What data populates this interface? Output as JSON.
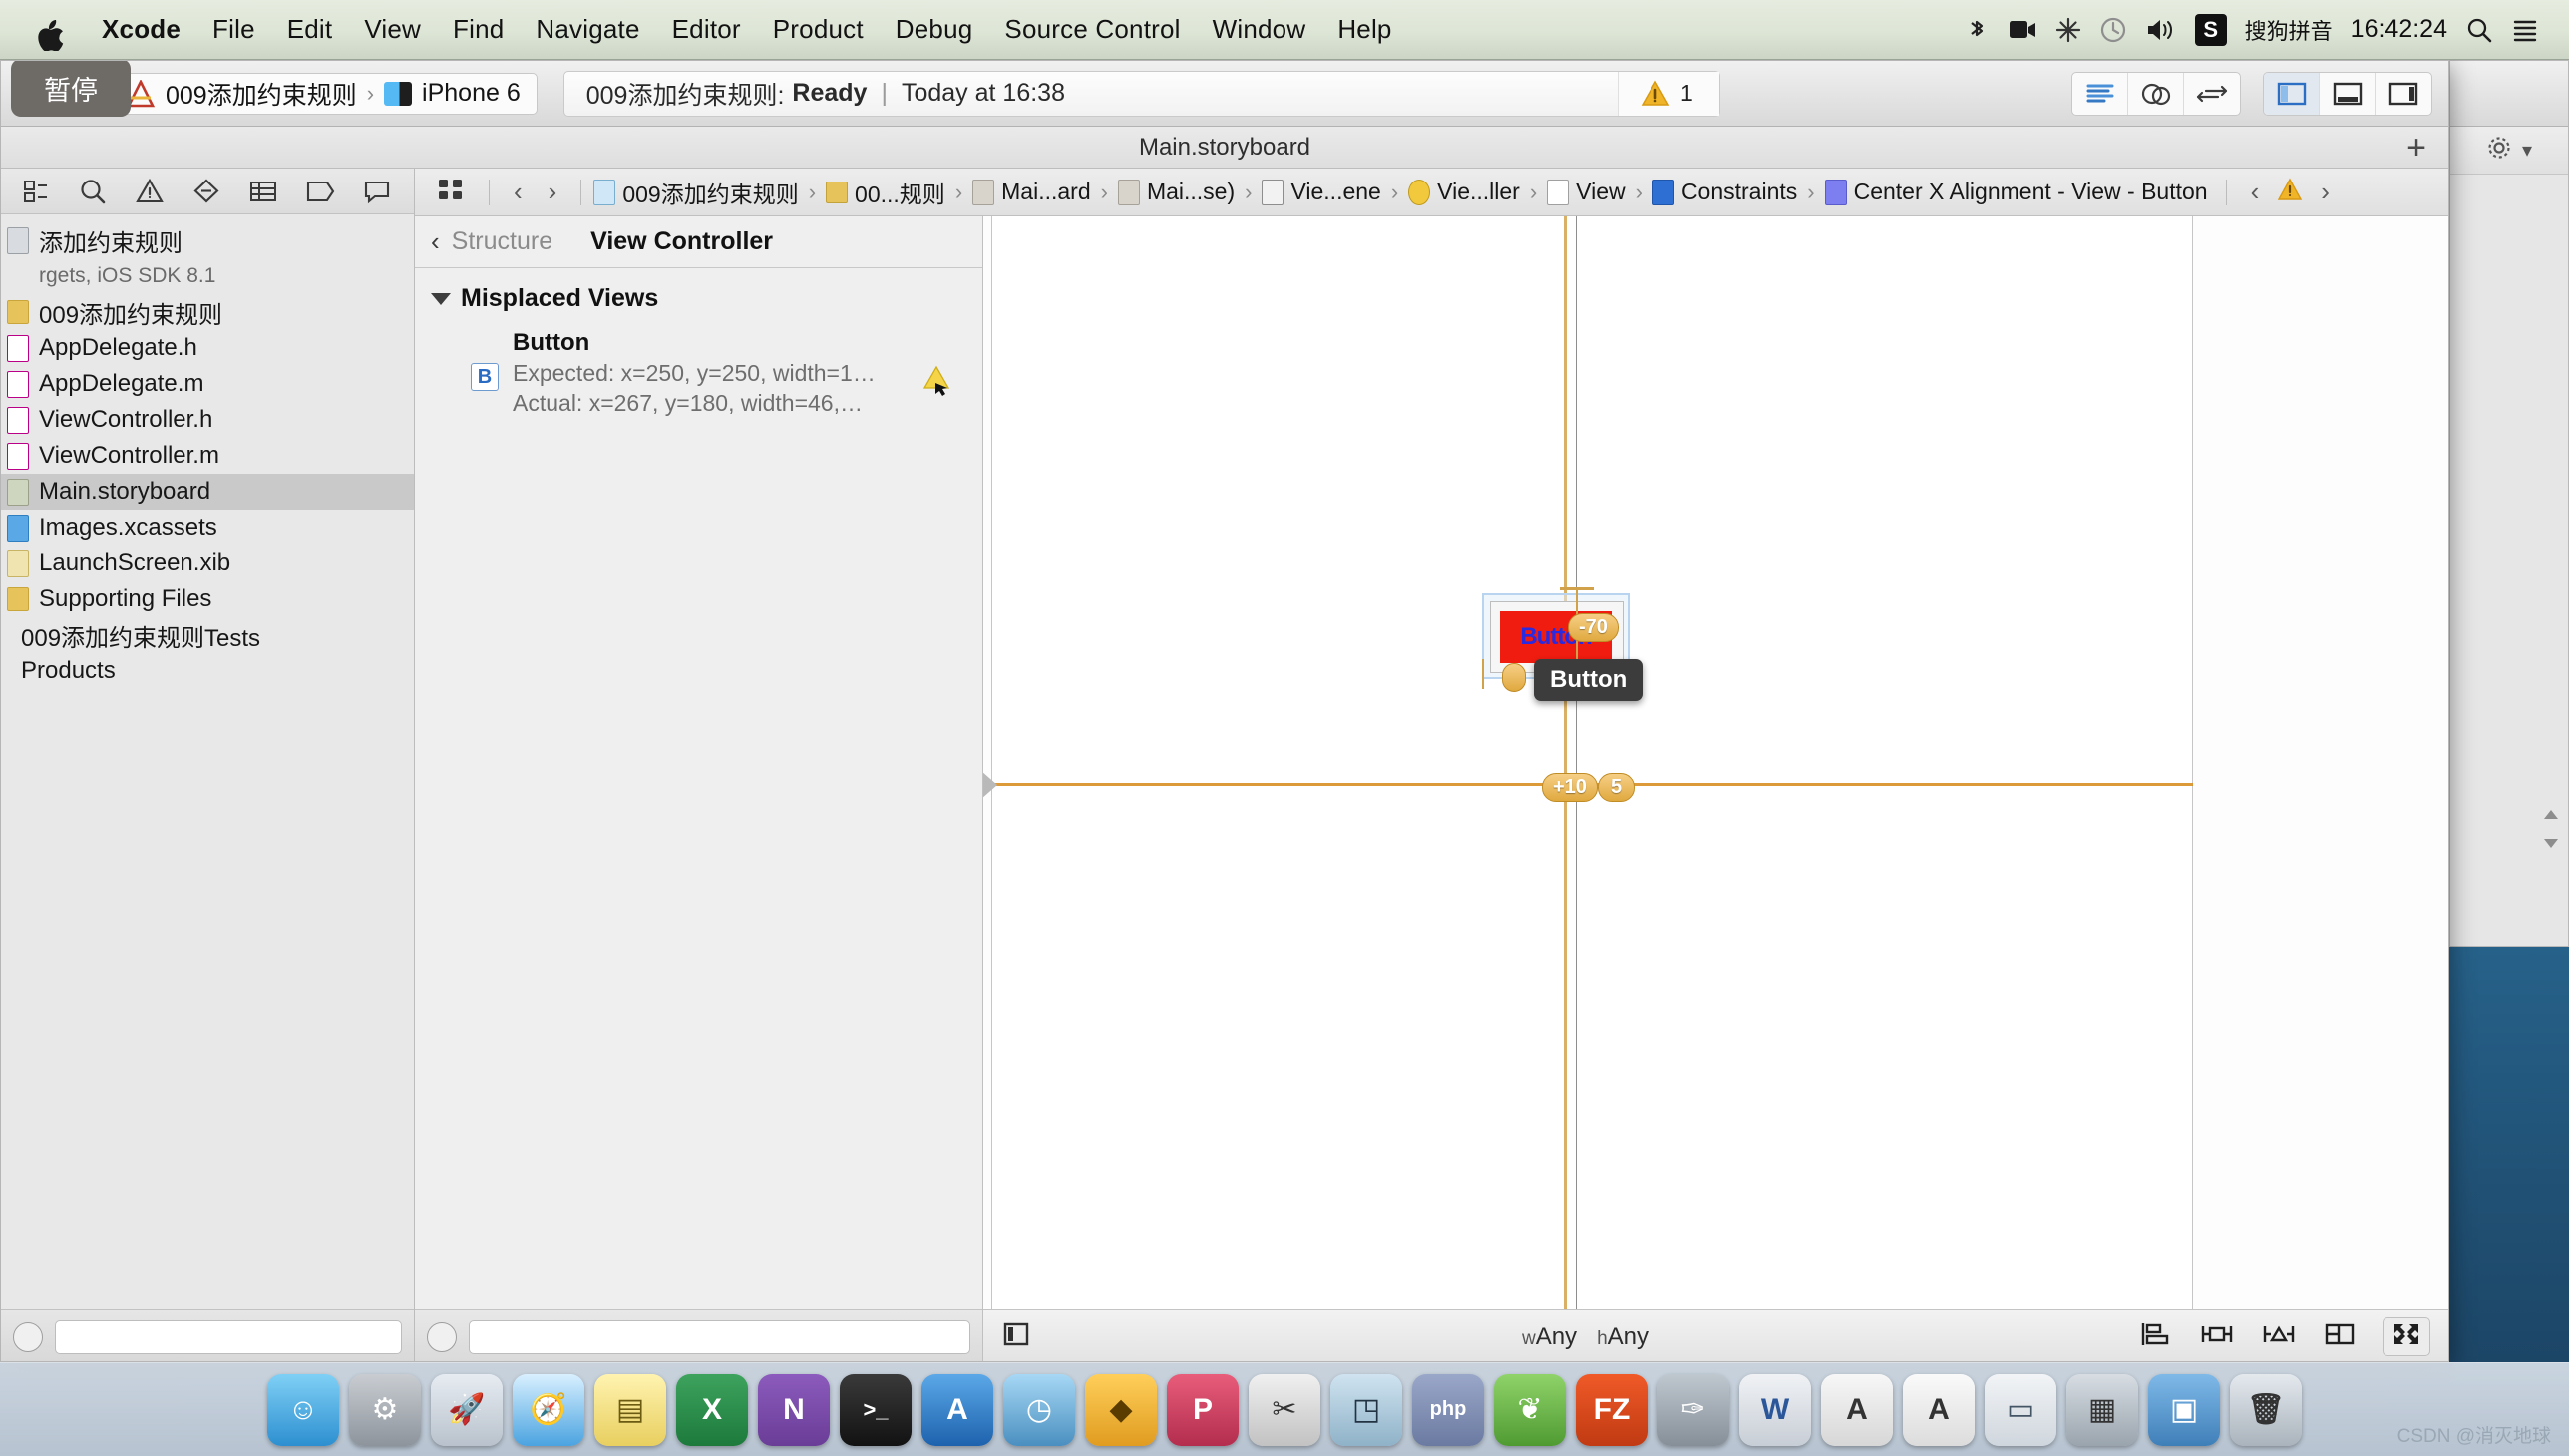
{
  "menubar": {
    "apple_icon": "apple-icon",
    "items": [
      "Xcode",
      "File",
      "Edit",
      "View",
      "Find",
      "Navigate",
      "Editor",
      "Product",
      "Debug",
      "Source Control",
      "Window",
      "Help"
    ],
    "status_icons": [
      "bluetooth-icon",
      "screen-record-icon",
      "airplay-icon",
      "timemachine-icon",
      "volume-icon"
    ],
    "input_method_badge": "S",
    "input_method_label": "搜狗拼音",
    "clock": "16:42:24",
    "spotlight_icon": "search-icon",
    "notification_icon": "list-icon"
  },
  "toolbar": {
    "pause_tooltip": "暂停",
    "run_icon": "play-icon",
    "stop_icon": "stop-icon",
    "scheme_project": "009添加约束规则",
    "scheme_separator": "›",
    "scheme_device": "iPhone 6",
    "status_project": "009添加约束规则:",
    "status_state": "Ready",
    "status_sep": "|",
    "status_time": "Today at 16:38",
    "warning_icon": "warning-icon",
    "warning_count": "1",
    "editor_modes": [
      "standard-editor-icon",
      "assistant-editor-icon",
      "version-editor-icon"
    ],
    "view_toggles": [
      "navigator-toggle-icon",
      "debug-area-toggle-icon",
      "utilities-toggle-icon"
    ]
  },
  "document_strip": {
    "title": "Main.storyboard",
    "add_tab_icon": "plus-icon"
  },
  "navigator": {
    "tabs": [
      "project-navigator-icon",
      "search-navigator-icon",
      "issue-navigator-icon",
      "test-navigator-icon",
      "debug-navigator-icon",
      "breakpoint-navigator-icon",
      "report-navigator-icon"
    ],
    "rows": [
      {
        "label": "添加约束规则",
        "icon": "project-icon",
        "type": "project",
        "selected": false
      },
      {
        "label": "rgets, iOS SDK 8.1",
        "icon": "none",
        "type": "sub",
        "selected": false
      },
      {
        "label": "009添加约束规则",
        "icon": "folder-icon",
        "type": "group",
        "selected": false
      },
      {
        "label": "AppDelegate.h",
        "icon": "header-file-icon",
        "type": "file",
        "selected": false
      },
      {
        "label": "AppDelegate.m",
        "icon": "source-file-icon",
        "type": "file",
        "selected": false
      },
      {
        "label": "ViewController.h",
        "icon": "header-file-icon",
        "type": "file",
        "selected": false
      },
      {
        "label": "ViewController.m",
        "icon": "source-file-icon",
        "type": "file",
        "selected": false
      },
      {
        "label": "Main.storyboard",
        "icon": "storyboard-icon",
        "type": "file",
        "selected": true
      },
      {
        "label": "Images.xcassets",
        "icon": "assets-icon",
        "type": "file",
        "selected": false
      },
      {
        "label": "LaunchScreen.xib",
        "icon": "xib-icon",
        "type": "file",
        "selected": false
      },
      {
        "label": "Supporting Files",
        "icon": "folder-icon",
        "type": "group",
        "selected": false
      },
      {
        "label": "009添加约束规则Tests",
        "icon": "folder-icon",
        "type": "group",
        "selected": false
      },
      {
        "label": "Products",
        "icon": "folder-icon",
        "type": "group",
        "selected": false
      }
    ],
    "bottom": {
      "add_icon": "plus-circle-icon",
      "filter_placeholder": ""
    }
  },
  "jumpbar": {
    "grid_icon": "related-items-icon",
    "back_icon": "back-chevron-icon",
    "forward_icon": "forward-chevron-icon",
    "crumbs": [
      {
        "label": "009添加约束规则",
        "icon": "project-doc-icon",
        "kind": "doc"
      },
      {
        "label": "00...规则",
        "icon": "folder-icon",
        "kind": "fold"
      },
      {
        "label": "Mai...ard",
        "icon": "storyboard-file-icon",
        "kind": "gray"
      },
      {
        "label": "Mai...se)",
        "icon": "storyboard-file-icon",
        "kind": "gray"
      },
      {
        "label": "Vie...ene",
        "icon": "scene-icon",
        "kind": "scene"
      },
      {
        "label": "Vie...ller",
        "icon": "view-controller-icon",
        "kind": "vc"
      },
      {
        "label": "View",
        "icon": "view-icon",
        "kind": "view"
      },
      {
        "label": "Constraints",
        "icon": "constraints-icon",
        "kind": "cons"
      },
      {
        "label": "Center X Alignment - View - Button",
        "icon": "constraint-icon",
        "kind": "consp"
      }
    ],
    "issue_prev_icon": "prev-issue-icon",
    "issue_warning_icon": "warning-icon",
    "issue_next_icon": "next-issue-icon"
  },
  "document_outline": {
    "back_chevron": "back-chevron-icon",
    "back_label": "Structure",
    "title": "View Controller",
    "group_label": "Misplaced Views",
    "disclosure_icon": "disclosure-triangle-icon",
    "issue": {
      "badge": "B",
      "name": "Button",
      "expected": "Expected: x=250, y=250, width=1…",
      "actual": "Actual: x=267, y=180, width=46,…",
      "fix_icon": "warning-fix-icon"
    },
    "bottom": {
      "add_icon": "plus-circle-icon"
    }
  },
  "canvas": {
    "button_label": "Button",
    "tooltip_label": "Button",
    "constraint_badges": [
      {
        "value": "-70",
        "name": "vertical-spacing-badge"
      },
      {
        "value": "+10",
        "name": "center-x-offset-badge"
      },
      {
        "value": "5",
        "name": "center-y-offset-badge"
      }
    ],
    "guide_color": "#d98f24",
    "button_fill": "#f01c10",
    "button_text_color": "#2a2ae0"
  },
  "canvas_bottom": {
    "scene_toggle_icon": "document-outline-toggle-icon",
    "size_class_w": "w",
    "size_class_w_val": "Any",
    "size_class_h": "h",
    "size_class_h_val": "Any",
    "tools": [
      "align-icon",
      "pin-icon",
      "resolve-issues-icon",
      "stack-icon"
    ],
    "zoom_icon": "zoom-fit-icon"
  },
  "dock": {
    "items": [
      "finder-icon",
      "system-preferences-icon",
      "launchpad-icon",
      "safari-icon",
      "notes-icon",
      "excel-icon",
      "xcode-icon",
      "onenote-icon",
      "terminal-icon",
      "instruments-icon",
      "sketch-icon",
      "folder-icon",
      "prototype-icon",
      "scissors-icon",
      "screenshot-icon",
      "php-icon",
      "plant-icon",
      "filezilla-icon",
      "paint-icon",
      "word-icon",
      "font-book-icon",
      "textedit-icon",
      "preview-icon",
      "archive-icon",
      "wallpaper-icon",
      "trash-icon"
    ]
  },
  "watermark": "CSDN @消灭地球"
}
